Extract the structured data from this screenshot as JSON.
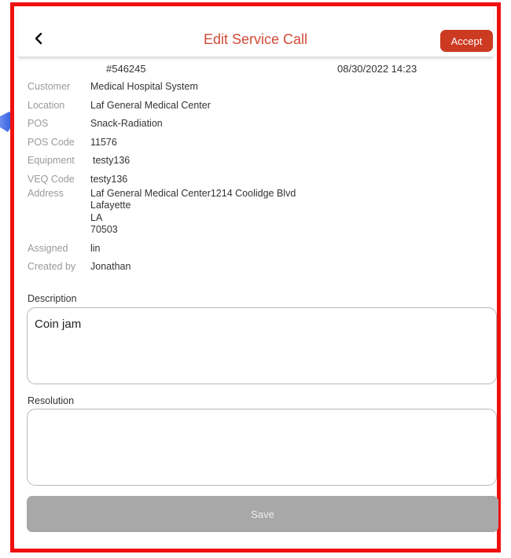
{
  "header": {
    "title": "Edit Service Call",
    "accept_label": "Accept",
    "back_icon": "chevron-left-icon"
  },
  "call": {
    "id": "#546245",
    "datetime": "08/30/2022 14:23"
  },
  "fields": {
    "customer": {
      "label": "Customer",
      "value": "Medical Hospital System"
    },
    "location": {
      "label": "Location",
      "value": "Laf General Medical Center"
    },
    "pos": {
      "label": "POS",
      "value": "Snack-Radiation"
    },
    "pos_code": {
      "label": "POS Code",
      "value": "11576"
    },
    "equipment": {
      "label": "Equipment",
      "value": "testy136"
    },
    "veq_code": {
      "label": "VEQ Code",
      "value": "testy136"
    },
    "address": {
      "label": "Address",
      "lines": [
        "Laf General Medical Center1214 Coolidge Blvd",
        "Lafayette",
        "LA",
        "70503"
      ]
    },
    "assigned": {
      "label": "Assigned",
      "value": "lin"
    },
    "created_by": {
      "label": "Created by",
      "value": "Jonathan"
    }
  },
  "description": {
    "label": "Description",
    "value": "Coin jam"
  },
  "resolution": {
    "label": "Resolution",
    "value": ""
  },
  "save_label": "Save",
  "colors": {
    "accent": "#cc3a22",
    "title": "#d24a37",
    "frame_border": "#f01010",
    "arrow": "#1f4fd6",
    "save_disabled": "#a8a8a8"
  }
}
